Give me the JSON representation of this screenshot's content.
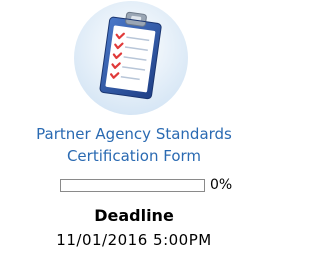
{
  "form": {
    "icon": "clipboard-checklist-icon",
    "title_line1": "Partner Agency Standards",
    "title_line2": "Certification Form",
    "progress_percent": 0,
    "progress_label": "0%"
  },
  "deadline": {
    "label": "Deadline",
    "value": "11/01/2016 5:00PM"
  },
  "colors": {
    "title_link": "#2a6ab2",
    "progress_border": "#8a8a8a",
    "progress_fill": "#4a8ed6",
    "icon_circle": "#dceaf6",
    "clipboard": "#2f5aa6",
    "checkmark": "#e03a3a"
  }
}
